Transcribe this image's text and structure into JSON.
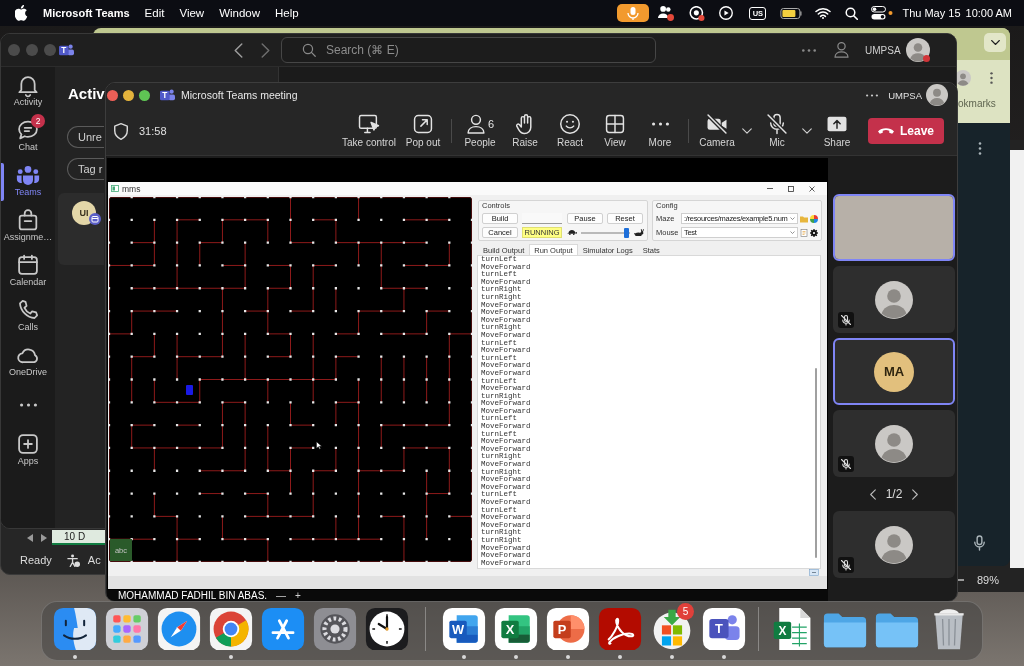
{
  "menu_bar": {
    "app_name": "Microsoft Teams",
    "menus": [
      "Edit",
      "View",
      "Window",
      "Help"
    ],
    "input_source": "US",
    "date": "Thu May 15",
    "time": "10:00 AM"
  },
  "back_window": {
    "panel_title": "okmarks"
  },
  "spreadsheet_right": {
    "zoom": "89%"
  },
  "spreadsheet_left": {
    "sheet_tab": "10 D",
    "status": "Ready",
    "accessibility": "Ac"
  },
  "teams_window": {
    "logo_letter": "T",
    "search": {
      "placeholder": "Search (⌘ E)"
    },
    "account": "UMPSA",
    "busy": true,
    "rail": [
      {
        "kind": "activity",
        "label": "Activity",
        "selected": false
      },
      {
        "kind": "chat",
        "label": "Chat",
        "badge": "2",
        "selected": false
      },
      {
        "kind": "teams",
        "label": "Teams",
        "selected": true
      },
      {
        "kind": "assignments",
        "label": "Assignme…",
        "selected": false
      },
      {
        "kind": "calendar",
        "label": "Calendar",
        "selected": false
      },
      {
        "kind": "calls",
        "label": "Calls",
        "selected": false
      },
      {
        "kind": "onedrive",
        "label": "OneDrive",
        "selected": false
      },
      {
        "kind": "more",
        "selected": false
      },
      {
        "kind": "apps",
        "label": "Apps",
        "selected": false
      }
    ],
    "heading": "Activ",
    "filters": [
      "Unre",
      "Tag r"
    ],
    "card": {
      "initials": "UI"
    }
  },
  "meeting": {
    "logo_letter": "T",
    "title": "Microsoft Teams meeting",
    "account": "UMPSA",
    "timer": "31:58",
    "toolbar": [
      [
        {
          "kind": "take_control",
          "label": "Take control"
        },
        {
          "kind": "pop_out",
          "label": "Pop out"
        }
      ],
      [
        {
          "kind": "people",
          "label": "People",
          "count": "6"
        },
        {
          "kind": "raise",
          "label": "Raise"
        },
        {
          "kind": "react",
          "label": "React"
        },
        {
          "kind": "view",
          "label": "View"
        },
        {
          "kind": "more",
          "label": "More"
        }
      ],
      [
        {
          "kind": "camera",
          "label": "Camera",
          "off": true,
          "menu": true
        },
        {
          "kind": "mic",
          "label": "Mic",
          "off": true,
          "menu": true
        },
        {
          "kind": "share",
          "label": "Share"
        }
      ]
    ],
    "leave": "Leave",
    "presenter": "MOHAMMAD FADHIL BIN ABAS.",
    "zoom_out": "—",
    "zoom_in": "+",
    "participants": [
      {
        "kind": "video",
        "speaking": true,
        "muted": false
      },
      {
        "kind": "avatar",
        "speaking": false,
        "muted": true
      },
      {
        "kind": "initials",
        "initials": "MA",
        "speaking": true,
        "muted": false
      },
      {
        "kind": "avatar",
        "speaking": false,
        "muted": true
      }
    ],
    "pager": "1/2",
    "more_participants": [
      {
        "kind": "avatar",
        "speaking": false,
        "muted": true
      }
    ]
  },
  "mms": {
    "title": "mms",
    "cell_label": "abc",
    "controls": {
      "title": "Controls",
      "build": "Build",
      "pause": "Pause",
      "reset": "Reset",
      "cancel": "Cancel",
      "status": "RUNNING",
      "speed": {
        "level": 0.97
      }
    },
    "config": {
      "title": "Config",
      "maze": {
        "label": "Maze",
        "value": ":/resources/mazes/example5.num"
      },
      "mouse": {
        "label": "Mouse",
        "value": "Test"
      }
    },
    "tabs": [
      {
        "label": "Build Output",
        "selected": false
      },
      {
        "label": "Run Output",
        "selected": true
      },
      {
        "label": "Simulator Logs",
        "selected": false
      },
      {
        "label": "Stats",
        "selected": false
      }
    ],
    "output": [
      "turnLeft",
      "MoveForward",
      "turnLeft",
      "MoveForward",
      "turnRight",
      "turnRight",
      "MoveForward",
      "MoveForward",
      "MoveForward",
      "turnRight",
      "MoveForward",
      "turnLeft",
      "MoveForward",
      "turnLeft",
      "MoveForward",
      "MoveForward",
      "turnLeft",
      "MoveForward",
      "turnRight",
      "MoveForward",
      "MoveForward",
      "turnLeft",
      "MoveForward",
      "turnLeft",
      "MoveForward",
      "MoveForward",
      "turnRight",
      "MoveForward",
      "turnRight",
      "MoveForward",
      "MoveForward",
      "turnLeft",
      "MoveForward",
      "turnLeft",
      "MoveForward",
      "MoveForward",
      "turnRight",
      "turnRight",
      "MoveForward",
      "MoveForward",
      "MoveForward"
    ]
  },
  "dock": [
    [
      {
        "kind": "finder",
        "running": true
      },
      {
        "kind": "launchpad",
        "running": false
      },
      {
        "kind": "safari",
        "running": false
      },
      {
        "kind": "chrome",
        "running": true
      },
      {
        "kind": "appstore",
        "running": false
      },
      {
        "kind": "settings",
        "running": false
      },
      {
        "kind": "clock",
        "running": false
      }
    ],
    [
      {
        "kind": "word",
        "letter": "W",
        "running": true
      },
      {
        "kind": "excel",
        "letter": "X",
        "running": true
      },
      {
        "kind": "powerpoint",
        "letter": "P",
        "running": true
      },
      {
        "kind": "acrobat",
        "running": true
      },
      {
        "kind": "store",
        "badge": "5",
        "running": true
      },
      {
        "kind": "teams",
        "letter": "T",
        "running": true
      }
    ],
    [
      {
        "kind": "xlsx",
        "letter": "X",
        "running": false
      },
      {
        "kind": "folder",
        "running": false
      },
      {
        "kind": "folder",
        "running": false
      },
      {
        "kind": "trash",
        "running": false
      }
    ]
  ]
}
